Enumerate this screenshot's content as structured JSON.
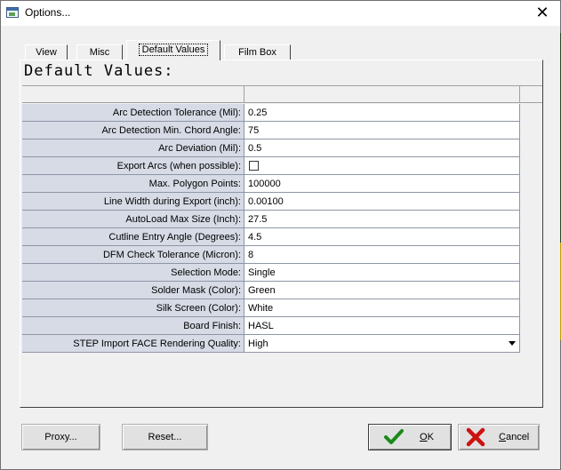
{
  "window": {
    "title": "Options...",
    "close_glyph": "✕"
  },
  "tabs": [
    {
      "label": "View",
      "active": false
    },
    {
      "label": "Misc",
      "active": false
    },
    {
      "label": "Default Values",
      "active": true
    },
    {
      "label": "Film Box",
      "active": false
    }
  ],
  "page": {
    "heading": "Default Values:"
  },
  "settings": [
    {
      "label": "Arc Detection Tolerance (Mil):",
      "value": "0.25"
    },
    {
      "label": "Arc Detection Min. Chord Angle:",
      "value": "75"
    },
    {
      "label": "Arc Deviation (Mil):",
      "value": "0.5"
    },
    {
      "label": "Export Arcs (when possible):",
      "value": "",
      "checked": false
    },
    {
      "label": "Max. Polygon Points:",
      "value": "100000"
    },
    {
      "label": "Line Width during Export (inch):",
      "value": "0.00100"
    },
    {
      "label": "AutoLoad Max Size (Inch):",
      "value": "27.5"
    },
    {
      "label": "Cutline Entry Angle (Degrees):",
      "value": "4.5"
    },
    {
      "label": "DFM Check Tolerance (Micron):",
      "value": "8"
    },
    {
      "label": "Selection Mode:",
      "value": "Single"
    },
    {
      "label": "Solder Mask (Color):",
      "value": "Green"
    },
    {
      "label": "Silk Screen (Color):",
      "value": "White"
    },
    {
      "label": "Board Finish:",
      "value": "HASL"
    },
    {
      "label": "STEP Import FACE Rendering Quality:",
      "value": "High"
    }
  ],
  "buttons": {
    "proxy": "Proxy...",
    "reset": "Reset...",
    "ok": "OK",
    "cancel": "Cancel"
  },
  "colors": {
    "label_bg": "#d6dbe6",
    "ok_check": "#1a8a1a",
    "cancel_x": "#cc1111"
  },
  "icons": {
    "ok": "checkmark-icon",
    "cancel": "red-x-icon",
    "dropdown": "triangle-down-icon"
  }
}
